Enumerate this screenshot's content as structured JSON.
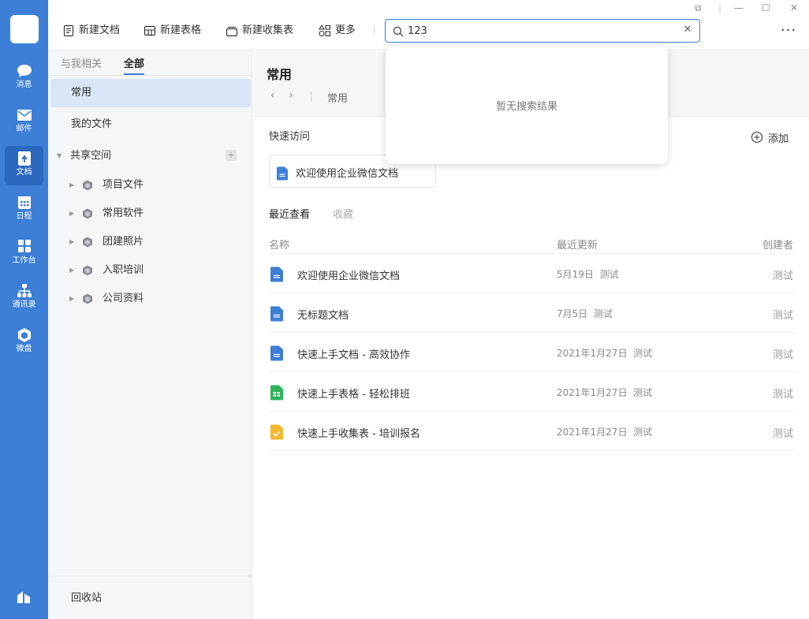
{
  "rail": {
    "items": [
      {
        "label": "消息",
        "icon": "chat-bubble-icon"
      },
      {
        "label": "邮件",
        "icon": "mail-icon"
      },
      {
        "label": "文档",
        "icon": "document-icon"
      },
      {
        "label": "日程",
        "icon": "calendar-icon"
      },
      {
        "label": "工作台",
        "icon": "workbench-icon"
      },
      {
        "label": "通讯录",
        "icon": "contacts-icon"
      },
      {
        "label": "微盘",
        "icon": "drive-icon"
      }
    ],
    "active_index": 2
  },
  "sidebar": {
    "tab_related": "与我相关",
    "tab_all": "全部",
    "common": "常用",
    "my_files": "我的文件",
    "shared_space": "共享空间",
    "folders": [
      "项目文件",
      "常用软件",
      "团建照片",
      "入职培训",
      "公司资料"
    ],
    "recycle_bin": "回收站"
  },
  "toolbar": {
    "new_doc": "新建文档",
    "new_sheet": "新建表格",
    "new_form": "新建收集表",
    "more": "更多",
    "search_value": "123",
    "more_menu": "···"
  },
  "dropdown": {
    "empty_text": "暂无搜索结果"
  },
  "main": {
    "title": "常用",
    "breadcrumb": "常用",
    "quick_access_title": "快速访问",
    "add_label": "添加",
    "quick_card": "欢迎使用企业微信文档",
    "recent_tab": "最近查看",
    "favorites_tab": "收藏",
    "col_name": "名称",
    "col_updated": "最近更新",
    "col_creator": "创建者",
    "rows": [
      {
        "name": "欢迎使用企业微信文档",
        "date": "5月19日",
        "by": "测试",
        "creator": "测试",
        "type": "doc"
      },
      {
        "name": "无标题文档",
        "date": "7月5日",
        "by": "测试",
        "creator": "测试",
        "type": "doc"
      },
      {
        "name": "快速上手文档 - 高效协作",
        "date": "2021年1月27日",
        "by": "测试",
        "creator": "测试",
        "type": "doc"
      },
      {
        "name": "快速上手表格 - 轻松排班",
        "date": "2021年1月27日",
        "by": "测试",
        "creator": "测试",
        "type": "sheet"
      },
      {
        "name": "快速上手收集表 - 培训报名",
        "date": "2021年1月27日",
        "by": "测试",
        "creator": "测试",
        "type": "form"
      }
    ]
  },
  "colors": {
    "accent": "#3d7fd6",
    "doc": "#3d7fd6",
    "sheet": "#2fb55a",
    "form": "#f5b82e"
  }
}
